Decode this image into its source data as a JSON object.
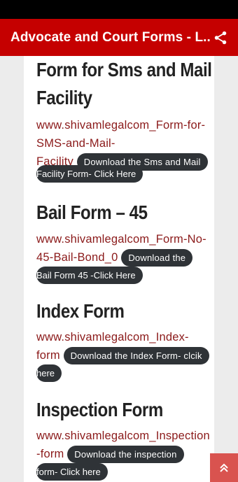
{
  "app_bar": {
    "title": "Advocate and Court Forms - L...",
    "share_icon": "share-icon",
    "color": "#c50000"
  },
  "forms": [
    {
      "heading_lines": [
        "Form for Sms and Mail",
        "Facility"
      ],
      "link_lines": [
        "www.shivamlegalcom_Form-for-",
        "SMS-and-Mail-",
        "Facility"
      ],
      "button_lines": [
        "Download the Sms and Mail",
        "Facility Form- Click Here"
      ]
    },
    {
      "heading_lines": [
        "Bail Form – 45"
      ],
      "link_lines": [
        "www.shivamlegalcom_Form-No-",
        "45-Bail-Bond_0"
      ],
      "button_lines": [
        "Download the",
        "Bail Form 45 -Click Here"
      ]
    },
    {
      "heading_lines": [
        "Index Form"
      ],
      "link_lines": [
        "www.shivamlegalcom_Index-",
        "form"
      ],
      "button_lines": [
        "Download the Index Form- clcik",
        "here"
      ]
    },
    {
      "heading_lines": [
        "Inspection Form"
      ],
      "link_lines": [
        "www.shivamlegalcom_Inspection",
        "-form"
      ],
      "button_lines": [
        "Download the inspection",
        "form- Click here"
      ]
    }
  ],
  "scroll_top": {
    "icon": "chevron-double-up-icon",
    "color": "#d9534f"
  }
}
